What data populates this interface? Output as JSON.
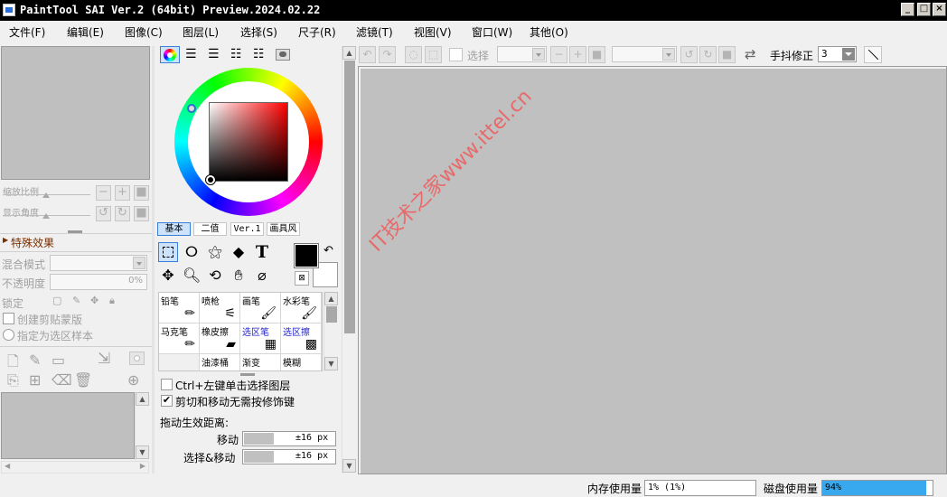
{
  "title": "PaintTool SAI Ver.2 (64bit) Preview.2024.02.22",
  "window_buttons": {
    "minimize": "_",
    "maximize": "□",
    "close": "×"
  },
  "menu": [
    "文件(F)",
    "编辑(E)",
    "图像(C)",
    "图层(L)",
    "选择(S)",
    "尺子(R)",
    "滤镜(T)",
    "视图(V)",
    "窗口(W)",
    "其他(O)"
  ],
  "navigator": {
    "zoom_label": "缩放比例",
    "angle_label": "显示角度"
  },
  "layer_panel": {
    "special_effects": "特殊效果",
    "blend_mode_label": "混合模式",
    "opacity_label": "不透明度",
    "opacity_value": "0%",
    "lock_label": "锁定",
    "clip_mask": "创建剪贴蒙版",
    "select_source": "指定为选区样本"
  },
  "color_panel": {
    "tabs": [
      "基本",
      "二值",
      "Ver.1",
      "画具风"
    ],
    "brushes": [
      {
        "name": "铅笔",
        "icon": "pencil-icon"
      },
      {
        "name": "喷枪",
        "icon": "airbrush-icon"
      },
      {
        "name": "画笔",
        "icon": "brush-icon"
      },
      {
        "name": "水彩笔",
        "icon": "watercolor-icon"
      },
      {
        "name": "马克笔",
        "icon": "marker-icon"
      },
      {
        "name": "橡皮擦",
        "icon": "eraser-icon"
      },
      {
        "name": "选区笔",
        "icon": "select-pen-icon"
      },
      {
        "name": "选区擦",
        "icon": "select-eraser-icon"
      },
      {
        "name": "",
        "icon": ""
      },
      {
        "name": "油漆桶",
        "icon": ""
      },
      {
        "name": "渐变",
        "icon": ""
      },
      {
        "name": "模糊",
        "icon": ""
      }
    ],
    "ctrl_click": "Ctrl+左键单击选择图层",
    "cut_move": "剪切和移动无需按修饰键",
    "drag_distance_label": "拖动生效距离:",
    "move_label": "移动",
    "move_value": "±16 px",
    "select_move_label": "选择&移动",
    "select_move_value": "±16 px"
  },
  "toolbar": {
    "select_label": "选择",
    "stabilizer_label": "手抖修正",
    "stabilizer_value": "3"
  },
  "watermark": "IT技术之家www.ittel.cn",
  "status": {
    "memory_label": "内存使用量",
    "memory_value": "1% (1%)",
    "disk_label": "磁盘使用量",
    "disk_value": "94%",
    "disk_fraction": 0.94
  },
  "colors": {
    "primary_color": "#000000",
    "secondary_color": "#ffffff",
    "disk_bar": "#39a9ef",
    "canvas_bg": "#c0c0c0"
  }
}
